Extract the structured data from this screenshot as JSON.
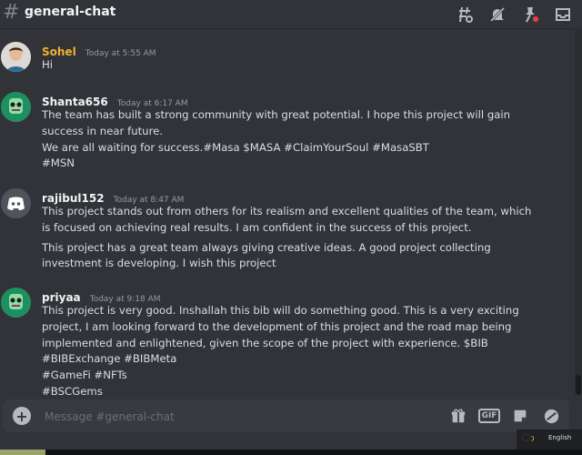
{
  "header": {
    "channel_name": "general-chat",
    "icons": [
      "threads-icon",
      "mute-bell-icon",
      "pin-icon",
      "inbox-icon"
    ]
  },
  "messages": [
    {
      "author": "Sohel",
      "author_color": "#f0b232",
      "time": "Today at 5:55 AM",
      "lines": [
        "Hi"
      ]
    },
    {
      "author": "Shanta656",
      "author_color": "#f2f3f5",
      "time": "Today at 6:17 AM",
      "lines": [
        "The team has built a strong community with great potential. I hope this project will gain success in near future.",
        "We are all waiting for success.#Masa $MASA #ClaimYourSoul #MasaSBT",
        "#MSN"
      ]
    },
    {
      "author": "rajibul152",
      "author_color": "#f2f3f5",
      "time": "Today at 8:47 AM",
      "lines": [
        "This project stands out from others for its realism and excellent qualities of the team, which is focused on achieving real results. I am confident in the success of this project.",
        "This project has a great team always giving creative ideas. A good project collecting investment is developing. I wish this project"
      ]
    },
    {
      "author": "priyaa",
      "author_color": "#f2f3f5",
      "time": "Today at 9:18 AM",
      "lines": [
        "This project is very good.  Inshallah this bib will do something good.  This is a very exciting project, I am looking forward to the development of this project and the road map being implemented and enlightened, given the scope of the project with experience.  $BIB #BIBExchange #BIBMeta",
        "#GameFi #NFTs",
        "#BSCGems"
      ]
    }
  ],
  "composer": {
    "placeholder": "Message #general-chat",
    "gif_label": "GIF"
  },
  "taskbar": {
    "language": "English"
  }
}
